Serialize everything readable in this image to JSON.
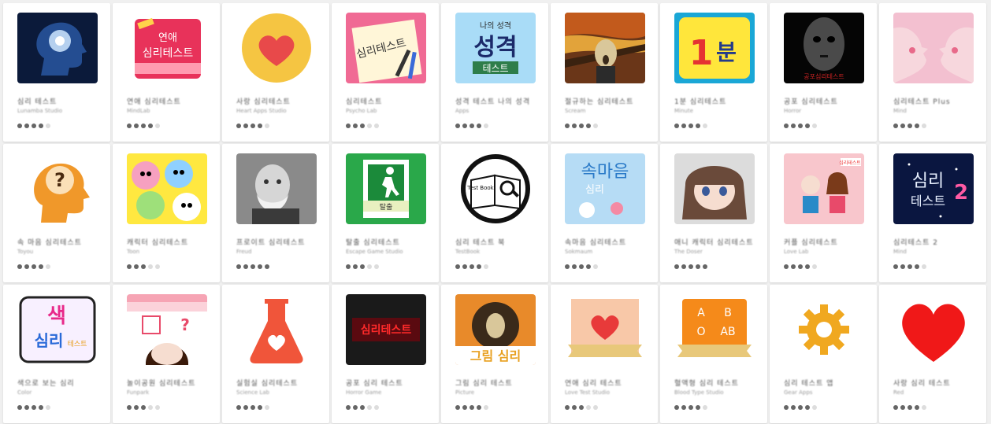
{
  "apps": [
    {
      "title": "심리 테스트",
      "developer": "Lunamba Studio",
      "rating": 4,
      "icon": "brain-head-icon"
    },
    {
      "title": "연애 심리테스트",
      "developer": "MindLab",
      "rating": 4,
      "icon": "love-notebook-icon"
    },
    {
      "title": "사랑 심리테스트",
      "developer": "Heart Apps Studio",
      "rating": 4,
      "icon": "heart-circle-icon"
    },
    {
      "title": "심리테스트",
      "developer": "Psycho Lab",
      "rating": 3,
      "icon": "note-pen-icon"
    },
    {
      "title": "성격 테스트 나의 성격",
      "developer": "Apps",
      "rating": 4,
      "icon": "personality-test-icon"
    },
    {
      "title": "절규하는 심리테스트",
      "developer": "Scream",
      "rating": 4,
      "icon": "scream-painting-icon"
    },
    {
      "title": "1분 심리테스트",
      "developer": "Minute",
      "rating": 4,
      "icon": "one-minute-icon"
    },
    {
      "title": "공포 심리테스트",
      "developer": "Horror",
      "rating": 4,
      "icon": "dark-face-icon"
    },
    {
      "title": "심리테스트 Plus",
      "developer": "Mind",
      "rating": 4,
      "icon": "kissing-faces-icon"
    },
    {
      "title": "속 마음 심리테스트",
      "developer": "Toyou",
      "rating": 4,
      "icon": "question-head-icon"
    },
    {
      "title": "캐릭터 심리테스트",
      "developer": "Toon",
      "rating": 3,
      "icon": "cartoon-characters-icon"
    },
    {
      "title": "프로이트 심리테스트",
      "developer": "Freud",
      "rating": 5,
      "icon": "freud-portrait-icon"
    },
    {
      "title": "탈출 심리테스트",
      "developer": "Escape Game Studio",
      "rating": 3,
      "icon": "exit-door-icon"
    },
    {
      "title": "심리 테스트 북",
      "developer": "TestBook",
      "rating": 4,
      "icon": "test-book-icon"
    },
    {
      "title": "속마음 심리테스트",
      "developer": "Sokmaum",
      "rating": 4,
      "icon": "inner-mind-icon"
    },
    {
      "title": "애니 캐릭터 심리테스트",
      "developer": "The Doser",
      "rating": 5,
      "icon": "anime-girl-icon"
    },
    {
      "title": "커플 심리테스트",
      "developer": "Love Lab",
      "rating": 4,
      "icon": "couple-icon"
    },
    {
      "title": "심리테스트 2",
      "developer": "Mind",
      "rating": 4,
      "icon": "test-two-icon"
    },
    {
      "title": "색으로 보는 심리",
      "developer": "Color",
      "rating": 4,
      "icon": "color-psychology-icon"
    },
    {
      "title": "놀이공원 심리테스트",
      "developer": "Funpark",
      "rating": 3,
      "icon": "girl-shop-icon"
    },
    {
      "title": "실험실 심리테스트",
      "developer": "Science Lab",
      "rating": 4,
      "icon": "heart-flask-icon"
    },
    {
      "title": "공포 심리 테스트",
      "developer": "Horror Game",
      "rating": 3,
      "icon": "horror-text-icon"
    },
    {
      "title": "그림 심리 테스트",
      "developer": "Picture",
      "rating": 4,
      "icon": "drawing-scream-icon"
    },
    {
      "title": "연애 심리 테스트",
      "developer": "Love Test Studio",
      "rating": 3,
      "icon": "heart-ribbon-icon"
    },
    {
      "title": "혈액형 심리 테스트",
      "developer": "Blood Type Studio",
      "rating": 4,
      "icon": "blood-type-icon"
    },
    {
      "title": "심리 테스트 앱",
      "developer": "Gear Apps",
      "rating": 4,
      "icon": "gear-icon"
    },
    {
      "title": "사랑 심리 테스트",
      "developer": "Red",
      "rating": 4,
      "icon": "red-heart-icon"
    }
  ],
  "icon_text": {
    "love_notebook": "연애 심리테스트",
    "note_pen": "심리테스트",
    "personality_top": "나의 성격",
    "personality_main": "성격",
    "personality_sub": "테스트",
    "one_minute": "1분",
    "dark_face_caption": "공포심리테스트",
    "exit_sign": "탈출",
    "test_book": "Test Book",
    "inner_mind_main": "속마음",
    "inner_mind_sub": "심리",
    "couple_badge": "심리테스트",
    "test_two_main": "심리",
    "test_two_sub": "테스트",
    "test_two_num": "2",
    "color_main": "색",
    "color_sub": "심리",
    "color_tag": "테스트",
    "horror_text": "심리테스트",
    "drawing_label": "그림 심리",
    "blood_a": "A",
    "blood_b": "B",
    "blood_o": "O",
    "blood_ab": "AB"
  },
  "colors": {
    "star_filled": "#666666",
    "star_empty": "#dddddd",
    "card_bg": "#ffffff",
    "page_bg": "#f0f0f0"
  }
}
